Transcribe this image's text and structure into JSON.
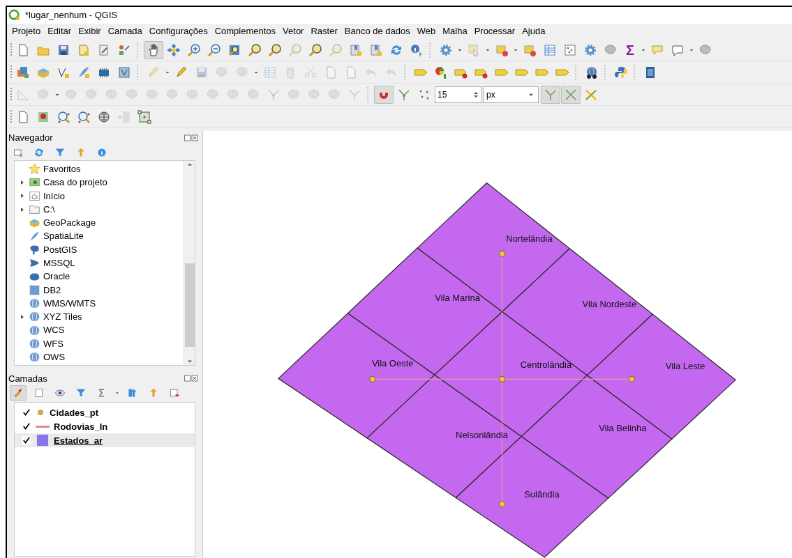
{
  "window": {
    "title": "*lugar_nenhum - QGIS"
  },
  "menu": [
    "Projeto",
    "Editar",
    "Exibir",
    "Camada",
    "Configurações",
    "Complementos",
    "Vetor",
    "Raster",
    "Banco de dados",
    "Web",
    "Malha",
    "Processar",
    "Ajuda"
  ],
  "toolbars": [
    {
      "items": [
        {
          "kind": "button",
          "pressed": false,
          "disabled": false
        },
        {
          "kind": "button",
          "pressed": false,
          "disabled": false
        },
        {
          "kind": "button",
          "pressed": false,
          "disabled": false
        },
        {
          "kind": "button",
          "pressed": false,
          "disabled": false
        },
        {
          "kind": "button",
          "pressed": false,
          "disabled": false
        },
        {
          "kind": "button",
          "pressed": false,
          "disabled": false
        },
        {
          "kind": "sep"
        },
        {
          "kind": "button",
          "pressed": true,
          "disabled": false
        },
        {
          "kind": "button",
          "pressed": false,
          "disabled": false
        },
        {
          "kind": "button",
          "pressed": false,
          "disabled": false
        },
        {
          "kind": "button",
          "pressed": false,
          "disabled": false
        },
        {
          "kind": "button",
          "pressed": false,
          "disabled": false
        },
        {
          "kind": "button",
          "pressed": false,
          "disabled": false
        },
        {
          "kind": "button",
          "pressed": false,
          "disabled": false
        },
        {
          "kind": "button",
          "pressed": false,
          "disabled": true
        },
        {
          "kind": "button",
          "pressed": false,
          "disabled": false
        },
        {
          "kind": "button",
          "pressed": false,
          "disabled": true
        },
        {
          "kind": "button",
          "pressed": false,
          "disabled": false
        },
        {
          "kind": "button",
          "pressed": false,
          "disabled": false
        },
        {
          "kind": "button",
          "pressed": false,
          "disabled": false
        },
        {
          "kind": "button",
          "pressed": false,
          "disabled": false
        },
        {
          "kind": "sep"
        },
        {
          "kind": "button",
          "pressed": false,
          "disabled": false
        },
        {
          "kind": "button",
          "pressed": false,
          "disabled": true
        },
        {
          "kind": "button",
          "pressed": false,
          "disabled": false
        },
        {
          "kind": "button",
          "pressed": false,
          "disabled": false
        },
        {
          "kind": "button",
          "pressed": false,
          "disabled": false
        },
        {
          "kind": "button",
          "pressed": false,
          "disabled": false
        },
        {
          "kind": "button",
          "pressed": false,
          "disabled": false
        },
        {
          "kind": "button",
          "pressed": false,
          "disabled": false
        },
        {
          "kind": "glyph",
          "text": "Σ",
          "pressed": false,
          "disabled": false
        },
        {
          "kind": "button",
          "pressed": false,
          "disabled": false
        },
        {
          "kind": "button",
          "pressed": false,
          "disabled": false
        },
        {
          "kind": "button",
          "pressed": false,
          "disabled": false
        }
      ]
    },
    {
      "items": [
        {
          "kind": "button",
          "pressed": false,
          "disabled": false
        },
        {
          "kind": "button",
          "pressed": false,
          "disabled": false
        },
        {
          "kind": "button",
          "pressed": false,
          "disabled": false
        },
        {
          "kind": "button",
          "pressed": false,
          "disabled": false
        },
        {
          "kind": "button",
          "pressed": false,
          "disabled": false
        },
        {
          "kind": "button",
          "pressed": false,
          "disabled": false
        },
        {
          "kind": "sep"
        },
        {
          "kind": "button",
          "pressed": false,
          "disabled": true
        },
        {
          "kind": "button",
          "pressed": false,
          "disabled": false
        },
        {
          "kind": "button",
          "pressed": false,
          "disabled": true
        },
        {
          "kind": "button",
          "pressed": false,
          "disabled": true
        },
        {
          "kind": "button",
          "pressed": false,
          "disabled": true
        },
        {
          "kind": "button",
          "pressed": false,
          "disabled": true
        },
        {
          "kind": "button",
          "pressed": false,
          "disabled": true
        },
        {
          "kind": "button",
          "pressed": false,
          "disabled": true
        },
        {
          "kind": "button",
          "pressed": false,
          "disabled": true
        },
        {
          "kind": "button",
          "pressed": false,
          "disabled": true
        },
        {
          "kind": "button",
          "pressed": false,
          "disabled": true
        },
        {
          "kind": "button",
          "pressed": false,
          "disabled": true
        },
        {
          "kind": "sep"
        },
        {
          "kind": "button",
          "pressed": false,
          "disabled": false
        },
        {
          "kind": "button",
          "pressed": false,
          "disabled": false
        },
        {
          "kind": "button",
          "pressed": false,
          "disabled": false
        },
        {
          "kind": "button",
          "pressed": false,
          "disabled": false
        },
        {
          "kind": "button",
          "pressed": false,
          "disabled": false
        },
        {
          "kind": "button",
          "pressed": false,
          "disabled": false
        },
        {
          "kind": "button",
          "pressed": false,
          "disabled": false
        },
        {
          "kind": "button",
          "pressed": false,
          "disabled": false
        },
        {
          "kind": "sep"
        },
        {
          "kind": "button",
          "pressed": false,
          "disabled": false
        },
        {
          "kind": "sep"
        },
        {
          "kind": "button",
          "pressed": false,
          "disabled": false
        },
        {
          "kind": "sep"
        },
        {
          "kind": "button",
          "pressed": false,
          "disabled": false
        }
      ]
    },
    {
      "items": [
        {
          "kind": "button",
          "pressed": false,
          "disabled": true
        },
        {
          "kind": "button",
          "pressed": false,
          "disabled": true
        },
        {
          "kind": "button",
          "pressed": false,
          "disabled": true
        },
        {
          "kind": "button",
          "pressed": false,
          "disabled": true
        },
        {
          "kind": "button",
          "pressed": false,
          "disabled": true
        },
        {
          "kind": "button",
          "pressed": false,
          "disabled": true
        },
        {
          "kind": "button",
          "pressed": false,
          "disabled": true
        },
        {
          "kind": "button",
          "pressed": false,
          "disabled": true
        },
        {
          "kind": "button",
          "pressed": false,
          "disabled": true
        },
        {
          "kind": "button",
          "pressed": false,
          "disabled": true
        },
        {
          "kind": "button",
          "pressed": false,
          "disabled": true
        },
        {
          "kind": "button",
          "pressed": false,
          "disabled": true
        },
        {
          "kind": "button",
          "pressed": false,
          "disabled": true
        },
        {
          "kind": "button",
          "pressed": false,
          "disabled": true
        },
        {
          "kind": "button",
          "pressed": false,
          "disabled": true
        },
        {
          "kind": "button",
          "pressed": false,
          "disabled": true
        },
        {
          "kind": "button",
          "pressed": false,
          "disabled": true
        },
        {
          "kind": "sep"
        },
        {
          "kind": "button",
          "pressed": true,
          "disabled": false
        },
        {
          "kind": "button",
          "pressed": false,
          "disabled": false
        },
        {
          "kind": "button",
          "pressed": false,
          "disabled": false
        },
        {
          "kind": "spin",
          "value": "15"
        },
        {
          "kind": "combo",
          "value": "px"
        },
        {
          "kind": "button",
          "pressed": true,
          "disabled": false
        },
        {
          "kind": "button",
          "pressed": true,
          "disabled": false
        },
        {
          "kind": "button",
          "pressed": false,
          "disabled": false
        }
      ]
    },
    {
      "items": [
        {
          "kind": "button",
          "pressed": false,
          "disabled": false
        },
        {
          "kind": "button",
          "pressed": false,
          "disabled": false
        },
        {
          "kind": "button",
          "pressed": false,
          "disabled": false
        },
        {
          "kind": "button",
          "pressed": false,
          "disabled": false
        },
        {
          "kind": "button",
          "pressed": false,
          "disabled": false
        },
        {
          "kind": "button",
          "pressed": false,
          "disabled": true
        },
        {
          "kind": "button",
          "pressed": false,
          "disabled": false
        }
      ]
    }
  ],
  "browser": {
    "title": "Navegador",
    "items": [
      {
        "label": "Favoritos",
        "expandable": false
      },
      {
        "label": "Casa do projeto",
        "expandable": true
      },
      {
        "label": "Início",
        "expandable": true
      },
      {
        "label": "C:\\",
        "expandable": true
      },
      {
        "label": "GeoPackage",
        "expandable": false
      },
      {
        "label": "SpatiaLite",
        "expandable": false
      },
      {
        "label": "PostGIS",
        "expandable": false
      },
      {
        "label": "MSSQL",
        "expandable": false
      },
      {
        "label": "Oracle",
        "expandable": false
      },
      {
        "label": "DB2",
        "expandable": false
      },
      {
        "label": "WMS/WMTS",
        "expandable": false
      },
      {
        "label": "XYZ Tiles",
        "expandable": true
      },
      {
        "label": "WCS",
        "expandable": false
      },
      {
        "label": "WFS",
        "expandable": false
      },
      {
        "label": "OWS",
        "expandable": false
      }
    ]
  },
  "layers": {
    "title": "Camadas",
    "items": [
      {
        "name": "Cidades_pt",
        "kind": "point",
        "color": "#d4b33a",
        "checked": true,
        "selected": false
      },
      {
        "name": "Rodovias_In",
        "kind": "line",
        "color": "#e08a8a",
        "checked": true,
        "selected": false
      },
      {
        "name": "Estados_ar",
        "kind": "polygon",
        "color": "#8b73ea",
        "checked": true,
        "selected": true
      }
    ]
  },
  "map": {
    "regions": [
      "Nortelândia",
      "Vila Marina",
      "Vila Nordeste",
      "Vila Oeste",
      "Centrolândia",
      "Vila Leste",
      "Nelsonlândia",
      "Vila Belinha",
      "Sulândia"
    ]
  }
}
